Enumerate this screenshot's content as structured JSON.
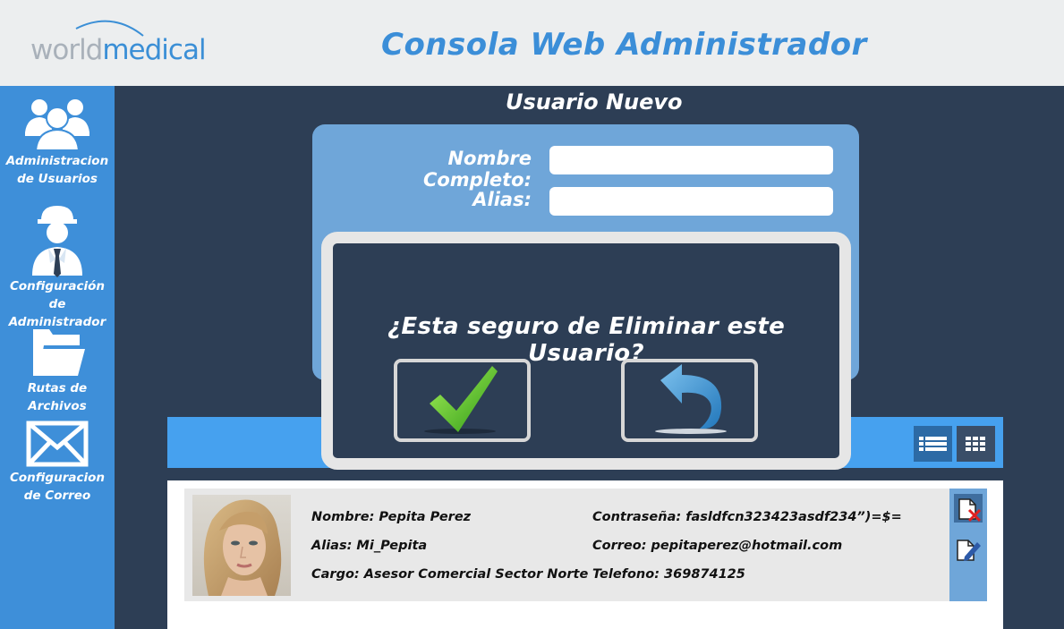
{
  "header": {
    "logo_world": "world",
    "logo_medical": "medical",
    "title": "Consola Web Administrador"
  },
  "sidebar": {
    "items": [
      {
        "label_line1": "Administracion",
        "label_line2": "de Usuarios",
        "icon": "users-icon"
      },
      {
        "label_line1": "Configuración",
        "label_line2": "de Administrador",
        "icon": "admin-worker-icon"
      },
      {
        "label_line1": "Rutas de",
        "label_line2": "Archivos",
        "icon": "folder-icon"
      },
      {
        "label_line1": "Configuracion",
        "label_line2": "de Correo",
        "icon": "envelope-icon"
      }
    ]
  },
  "form": {
    "title": "Usuario Nuevo",
    "full_name_label": "Nombre Completo:",
    "full_name_value": "",
    "alias_label": "Alias:",
    "alias_value": ""
  },
  "user": {
    "nombre": "Nombre: Pepita Perez",
    "alias": "Alias: Mi_Pepita",
    "cargo": "Cargo: Asesor Comercial Sector Norte",
    "contrasena": "Contraseña: fasldfcn323423asdf234”)=$=",
    "correo": "Correo: pepitaperez@hotmail.com",
    "telefono": "Telefono: 369874125"
  },
  "modal": {
    "question": "¿Esta seguro de Eliminar este Usuario?",
    "confirm_icon": "checkmark-icon",
    "cancel_icon": "back-arrow-icon"
  },
  "colors": {
    "sidebar": "#3e8fd9",
    "background": "#2d3e55",
    "header_title": "#3b8ed8",
    "confirm_green": "#5cc42b"
  }
}
